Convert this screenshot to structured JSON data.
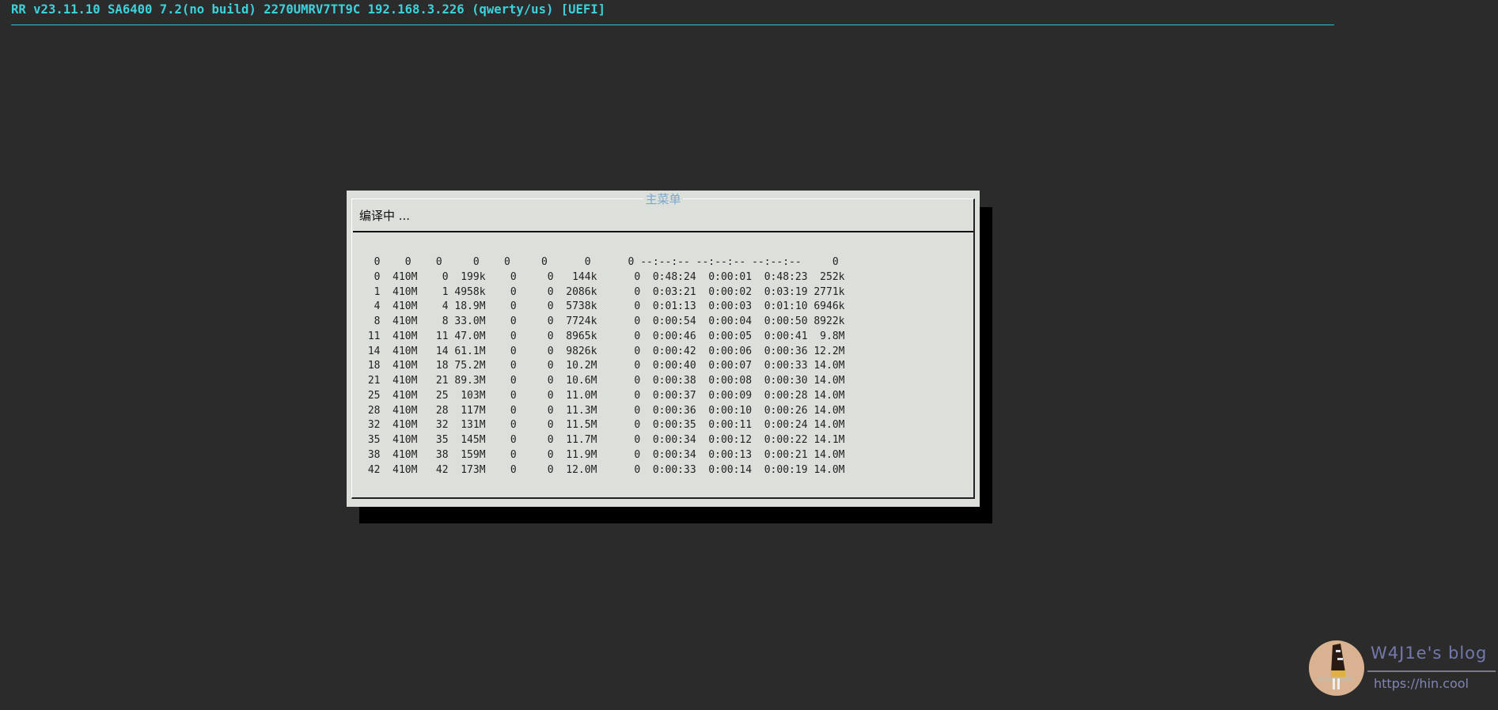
{
  "header": {
    "title": "RR v23.11.10 SA6400 7.2(no build) 2270UMRV7TT9C 192.168.3.226 (qwerty/us) [UEFI]",
    "accent_color": "#3cd2dc"
  },
  "dialog": {
    "title": "主菜单",
    "status": "编译中 ...",
    "rows": [
      "  0    0    0     0    0     0      0      0 --:--:-- --:--:-- --:--:--     0",
      "  0  410M    0  199k    0     0   144k      0  0:48:24  0:00:01  0:48:23  252k",
      "  1  410M    1 4958k    0     0  2086k      0  0:03:21  0:00:02  0:03:19 2771k",
      "  4  410M    4 18.9M    0     0  5738k      0  0:01:13  0:00:03  0:01:10 6946k",
      "  8  410M    8 33.0M    0     0  7724k      0  0:00:54  0:00:04  0:00:50 8922k",
      " 11  410M   11 47.0M    0     0  8965k      0  0:00:46  0:00:05  0:00:41  9.8M",
      " 14  410M   14 61.1M    0     0  9826k      0  0:00:42  0:00:06  0:00:36 12.2M",
      " 18  410M   18 75.2M    0     0  10.2M      0  0:00:40  0:00:07  0:00:33 14.0M",
      " 21  410M   21 89.3M    0     0  10.6M      0  0:00:38  0:00:08  0:00:30 14.0M",
      " 25  410M   25  103M    0     0  11.0M      0  0:00:37  0:00:09  0:00:28 14.0M",
      " 28  410M   28  117M    0     0  11.3M      0  0:00:36  0:00:10  0:00:26 14.0M",
      " 32  410M   32  131M    0     0  11.5M      0  0:00:35  0:00:11  0:00:24 14.0M",
      " 35  410M   35  145M    0     0  11.7M      0  0:00:34  0:00:12  0:00:22 14.1M",
      " 38  410M   38  159M    0     0  11.9M      0  0:00:34  0:00:13  0:00:21 14.0M",
      " 42  410M   42  173M    0     0  12.0M      0  0:00:33  0:00:14  0:00:19 14.0M"
    ]
  },
  "watermark": {
    "name": "W4J1e's blog",
    "url": "https://hin.cool"
  }
}
